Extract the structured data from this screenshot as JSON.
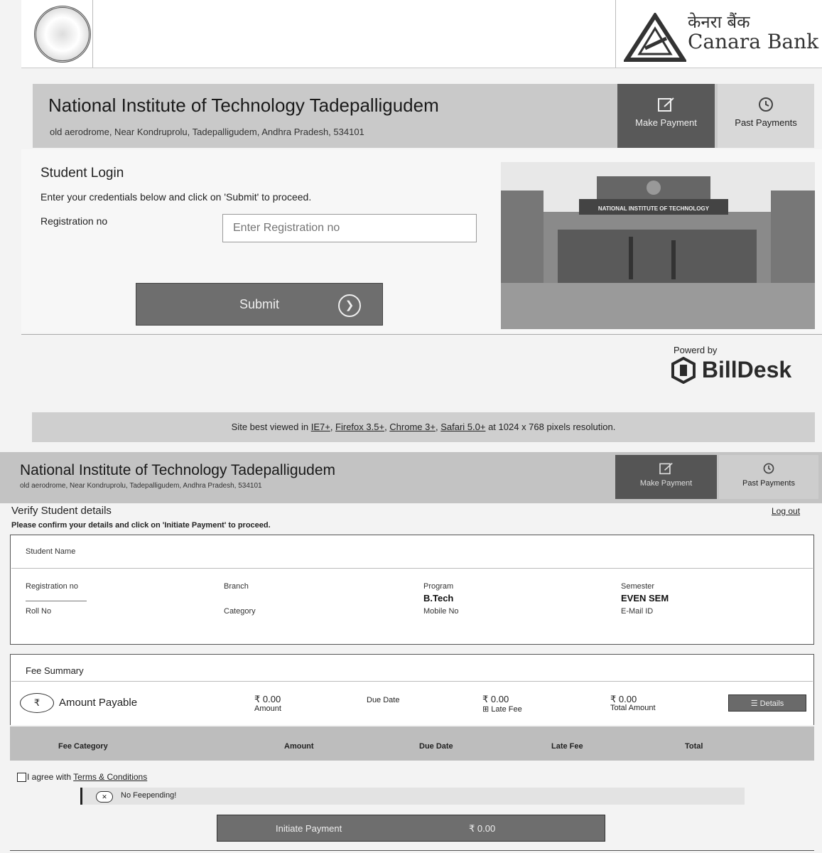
{
  "bank": {
    "hindi_name": "केनरा बैंक",
    "name": "Canara Bank"
  },
  "login_screen": {
    "institute_name": "National Institute of Technology Tadepalligudem",
    "address": "old aerodrome, Near Kondruprolu, Tadepalligudem, Andhra Pradesh, 534101",
    "nav": {
      "make_payment": "Make Payment",
      "past_payments": "Past Payments"
    },
    "title": "Student Login",
    "instruction": "Enter your credentials below and click on 'Submit' to proceed.",
    "registration_label": "Registration no",
    "registration_placeholder": "Enter Registration no",
    "submit_label": "Submit",
    "gate_sign": "NATIONAL INSTITUTE OF TECHNOLOGY",
    "powered_by": "Powerd by",
    "billdesk": "BillDesk",
    "footer": {
      "prefix": "Site best viewed in",
      "browsers": [
        "IE7+",
        "Firefox 3.5+",
        "Chrome 3+",
        "Safari 5.0+"
      ],
      "suffix": "at 1024 x 768 pixels resolution."
    }
  },
  "verify_screen": {
    "institute_name": "National Institute of Technology Tadepalligudem",
    "address": "old aerodrome, Near Kondruprolu, Tadepalligudem, Andhra Pradesh, 534101",
    "nav": {
      "make_payment": "Make Payment",
      "past_payments": "Past Payments"
    },
    "title": "Verify Student details",
    "logout": "Log out",
    "instruction": "Please confirm your details and click on 'Initiate Payment' to proceed.",
    "student": {
      "name_label": "Student Name",
      "registration_label": "Registration no",
      "branch_label": "Branch",
      "program_label": "Program",
      "program_value": "B.Tech",
      "semester_label": "Semester",
      "semester_value": "EVEN SEM",
      "roll_label": "Roll No",
      "category_label": "Category",
      "mobile_label": "Mobile No",
      "email_label": "E-Mail ID"
    },
    "fee": {
      "title": "Fee Summary",
      "rupee_symbol": "₹",
      "amount_payable_label": "Amount Payable",
      "amount_value": "₹ 0.00",
      "amount_sub": "Amount",
      "due_date_label": "Due Date",
      "late_fee_value": "₹ 0.00",
      "late_fee_sub": "⊞ Late Fee",
      "total_value": "₹ 0.00",
      "total_sub": "Total Amount",
      "details_label": "☰ Details"
    },
    "table_headers": [
      "Fee Category",
      "Amount",
      "Due Date",
      "Late Fee",
      "Total"
    ],
    "agree_prefix": "I agree with",
    "terms_link": "Terms & Conditions",
    "no_fee": "No Feepending!",
    "no_fee_icon": "✕",
    "initiate_label": "Initiate Payment",
    "initiate_amount": "₹ 0.00"
  }
}
